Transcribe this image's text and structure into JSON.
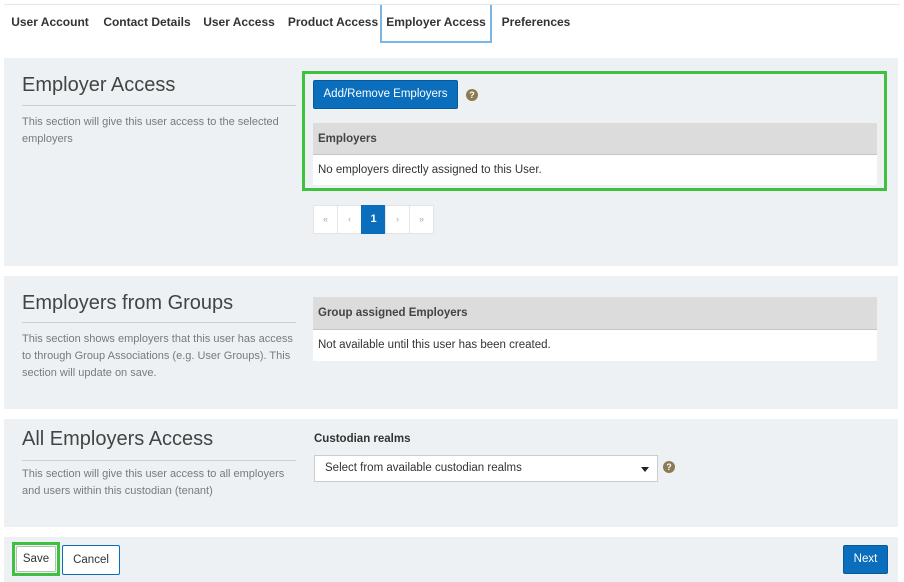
{
  "tabs": [
    {
      "label": "User Account"
    },
    {
      "label": "Contact Details"
    },
    {
      "label": "User Access"
    },
    {
      "label": "Product Access"
    },
    {
      "label": "Employer Access",
      "active": true
    },
    {
      "label": "Preferences"
    }
  ],
  "employer_access": {
    "title": "Employer Access",
    "description": "This section will give this user access to the selected employers",
    "add_remove_button": "Add/Remove Employers",
    "help_icon": "question-icon",
    "table_header": "Employers",
    "empty_message": "No employers directly assigned to this User.",
    "pagination": {
      "first": "«",
      "prev": "‹",
      "current_page": "1",
      "next": "›",
      "last": "»"
    }
  },
  "employers_from_groups": {
    "title": "Employers from Groups",
    "description": "This section shows employers that this user has access to through Group Associations (e.g. User Groups). This section will update on save.",
    "table_header": "Group assigned Employers",
    "empty_message": "Not available until this user has been created."
  },
  "all_employers_access": {
    "title": "All Employers Access",
    "description": "This section will give this user access to all employers and users within this custodian (tenant)",
    "realms_label": "Custodian realms",
    "realms_placeholder": "Select from available custodian realms",
    "help_icon": "question-icon"
  },
  "footer": {
    "save_label": "Save",
    "cancel_label": "Cancel",
    "next_label": "Next"
  },
  "colors": {
    "primary": "#0a6ebd",
    "highlight": "#3fc03f",
    "panel_bg": "#edf1f3",
    "active_tab_border": "#79b6e6"
  }
}
